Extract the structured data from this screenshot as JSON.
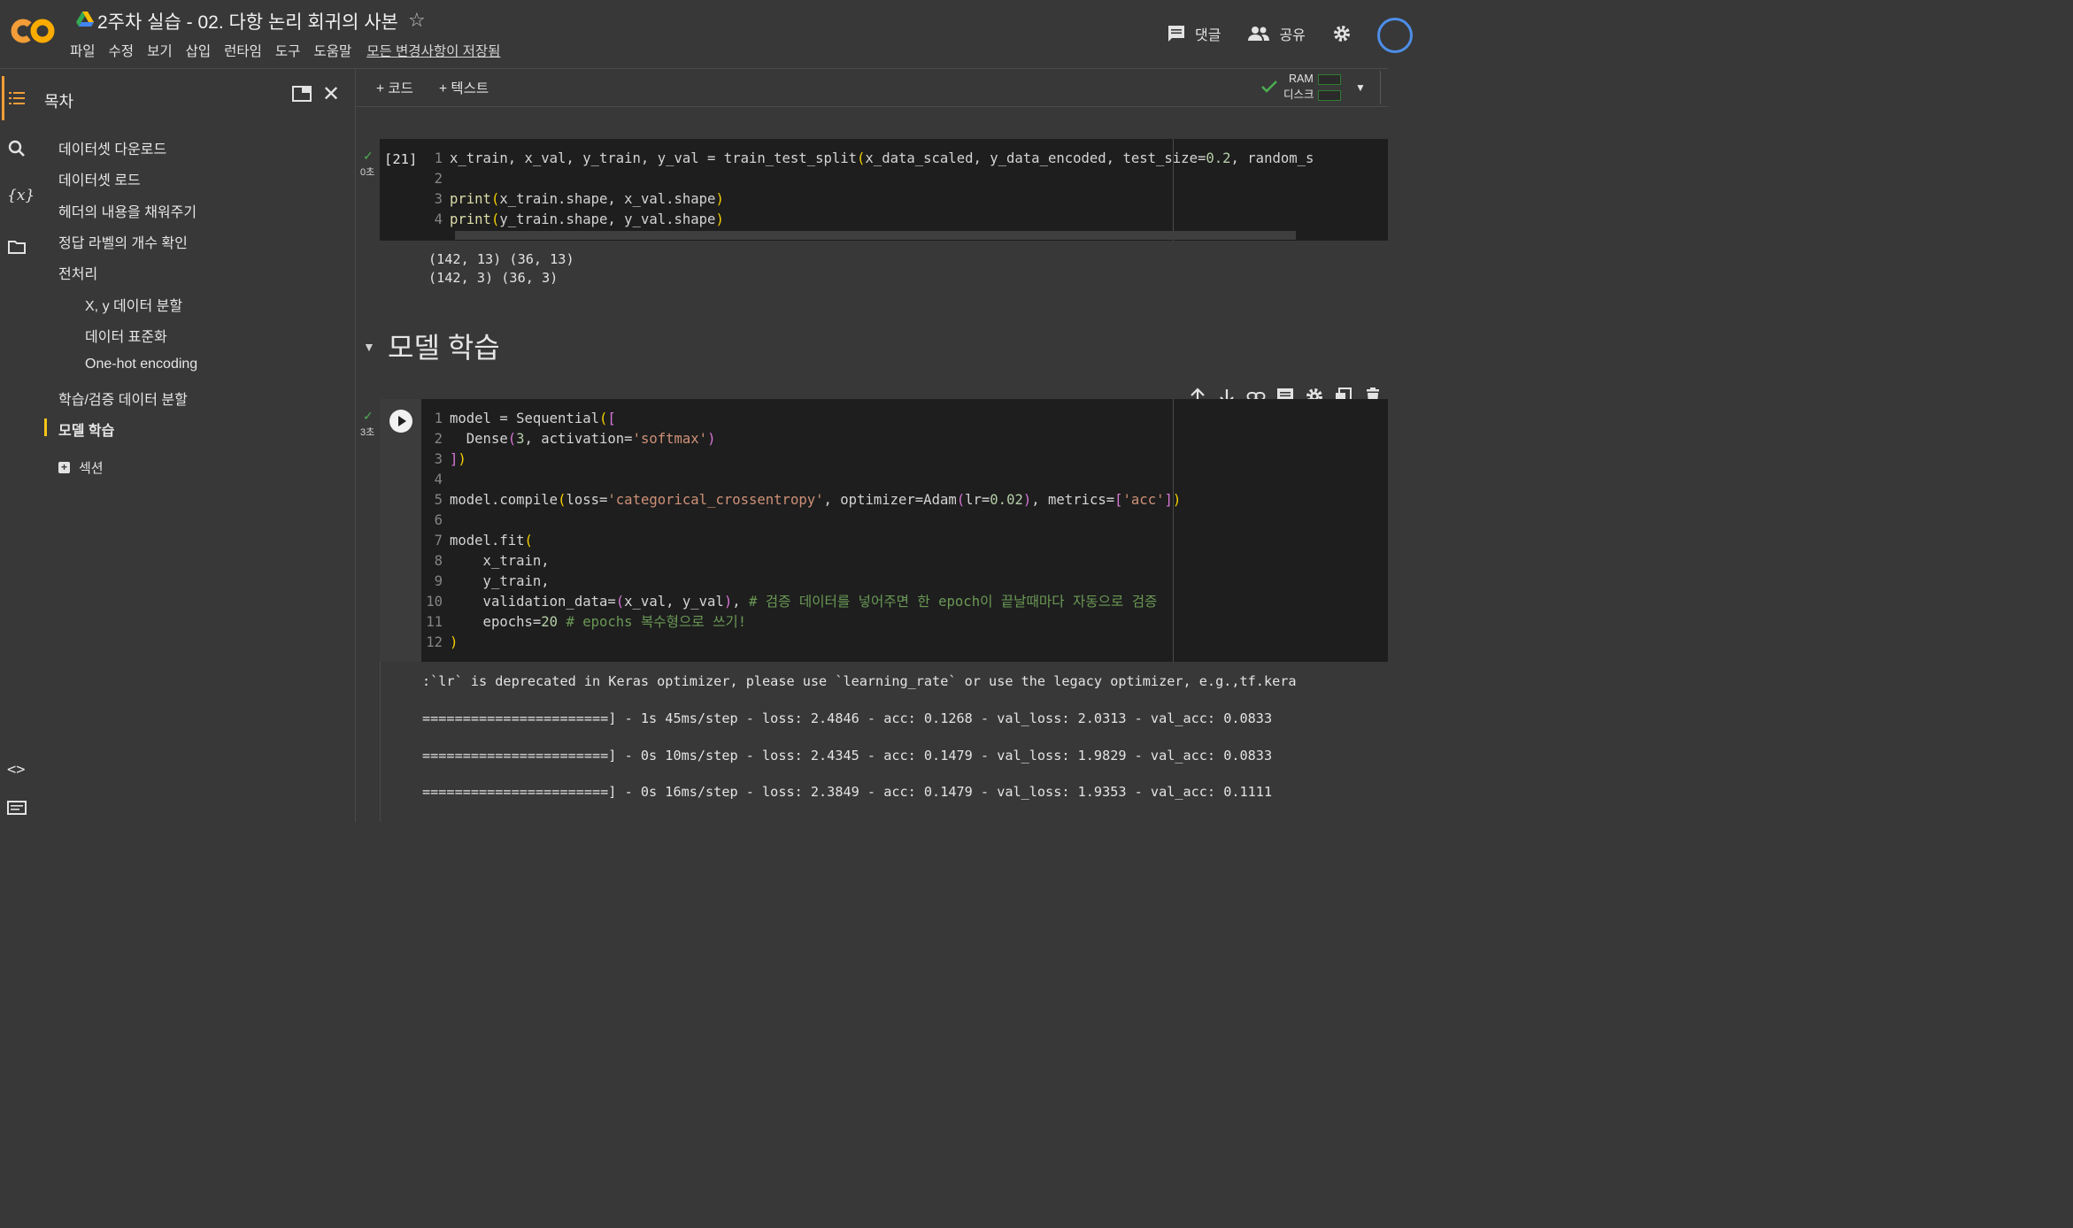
{
  "header": {
    "title": "2주차 실습 - 02. 다항 논리 회귀의 사본",
    "menu": [
      "파일",
      "수정",
      "보기",
      "삽입",
      "런타임",
      "도구",
      "도움말"
    ],
    "saved_status": "모든 변경사항이 저장됨",
    "comment_label": "댓글",
    "share_label": "공유"
  },
  "sidebar": {
    "title": "목차",
    "items": [
      {
        "label": "데이터셋 다운로드"
      },
      {
        "label": "데이터셋 로드"
      },
      {
        "label": "헤더의 내용을 채워주기"
      },
      {
        "label": "정답 라벨의 개수 확인"
      },
      {
        "label": "전처리"
      },
      {
        "label": "X, y 데이터 분할"
      },
      {
        "label": "데이터 표준화"
      },
      {
        "label": "One-hot encoding"
      },
      {
        "label": "학습/검증 데이터 분할"
      },
      {
        "label": "모델 학습"
      }
    ],
    "add_section": "섹션"
  },
  "toolbar": {
    "add_code": "+ 코드",
    "add_text": "+ 텍스트",
    "ram_label": "RAM",
    "disk_label": "디스크"
  },
  "cell1": {
    "exec_count": "[21]",
    "exec_time": "0초",
    "output": [
      "(142, 13) (36, 13)",
      "(142, 3) (36, 3)"
    ]
  },
  "section_heading": "모델 학습",
  "cell2": {
    "exec_time": "3초",
    "output": [
      ":`lr` is deprecated in Keras optimizer, please use `learning_rate` or use the legacy optimizer, e.g.,tf.kera",
      "=======================] - 1s 45ms/step - loss: 2.4846 - acc: 0.1268 - val_loss: 2.0313 - val_acc: 0.0833",
      "=======================] - 0s 10ms/step - loss: 2.4345 - acc: 0.1479 - val_loss: 1.9829 - val_acc: 0.0833",
      "=======================] - 0s 16ms/step - loss: 2.3849 - acc: 0.1479 - val_loss: 1.9353 - val_acc: 0.1111"
    ]
  },
  "icons": {
    "rail": [
      "toc-icon",
      "search-icon",
      "variables-icon",
      "folder-icon",
      "code-snippets-icon",
      "terminal-icon"
    ],
    "cell_tools": [
      "move-up-icon",
      "move-down-icon",
      "link-icon",
      "comment-icon",
      "settings-icon",
      "mirror-icon",
      "delete-icon"
    ]
  },
  "colors": {
    "accent": "#f29d38",
    "active_toc": "#f5c518",
    "check": "#4caf50"
  }
}
